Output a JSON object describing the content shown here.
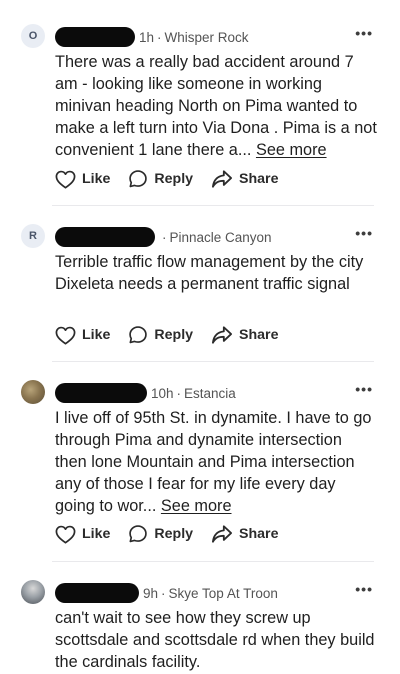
{
  "comments": [
    {
      "avatar_letter": "O",
      "time": "1h",
      "location": "Whisper Rock",
      "text": "There was a really bad accident around 7 am - looking like someone in working minivan heading North on Pima wanted to make a left turn into Via Dona . Pima is a not convenient 1 lane there a...",
      "see_more": "See more"
    },
    {
      "avatar_letter": "R",
      "time": "",
      "location": "Pinnacle Canyon",
      "text_line1": "Terrible traffic flow management by the city",
      "text_line2": "Dixeleta needs a permanent traffic signal"
    },
    {
      "avatar_letter": "",
      "time": "10h",
      "location": "Estancia",
      "text": "I live off of 95th St. in dynamite. I have to go through Pima and dynamite intersection then lone Mountain and Pima intersection any of those I fear for my life every day going to wor...",
      "see_more": "See more"
    },
    {
      "avatar_letter": "",
      "time": "9h",
      "location": "Skye Top At Troon",
      "text": "can't wait to see how they screw up scottsdale and scottsdale rd when they build the cardinals facility."
    }
  ],
  "actions": {
    "like": "Like",
    "reply": "Reply",
    "share": "Share"
  },
  "more_menu": "•••",
  "separator": "·"
}
